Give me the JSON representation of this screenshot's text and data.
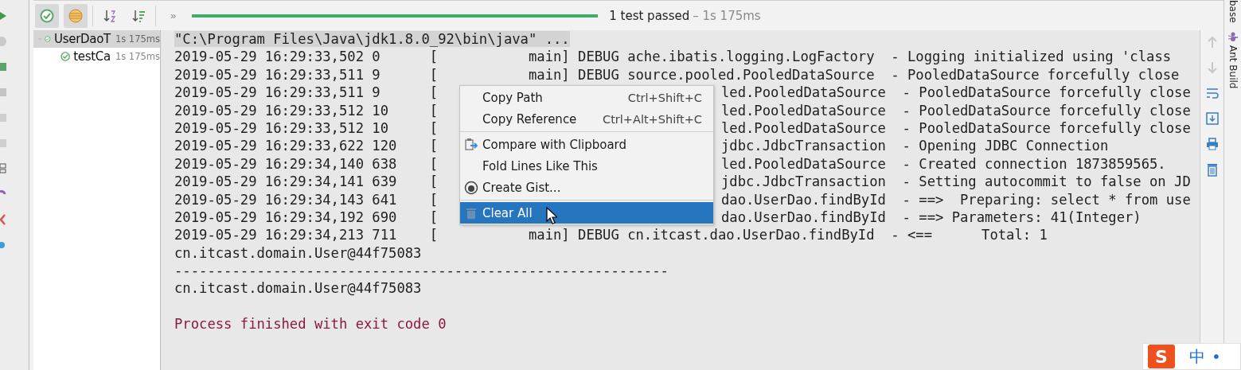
{
  "toolbar": {
    "buttons": [
      {
        "kind": "passed",
        "selected": true
      },
      {
        "kind": "ignored",
        "selected": true
      },
      {
        "kind": "sort-alpha",
        "selected": false
      },
      {
        "kind": "sort-duration",
        "selected": false
      }
    ],
    "overflow": "»",
    "progress": {
      "level": 1
    },
    "status": "1 test passed",
    "duration": "– 1s 175ms"
  },
  "tree": [
    {
      "name": "UserDaoT",
      "time": "1s 175ms",
      "selected": true,
      "expanded": true,
      "children": [
        {
          "name": "testCa",
          "time": "1s 175ms",
          "selected": false
        }
      ]
    }
  ],
  "console": {
    "lines": [
      {
        "kind": "command",
        "text": "\"C:\\Program Files\\Java\\jdk1.8.0_92\\bin\\java\" ..."
      },
      {
        "kind": "log",
        "text": "2019-05-29 16:29:33,502 0      [           main] DEBUG ache.ibatis.logging.LogFactory  - Logging initialized using 'class"
      },
      {
        "kind": "log",
        "text": "2019-05-29 16:29:33,511 9      [           main] DEBUG source.pooled.PooledDataSource  - PooledDataSource forcefully close"
      },
      {
        "kind": "split",
        "left": "2019-05-29 16:29:33,511 9      [",
        "right": "led.PooledDataSource  - PooledDataSource forcefully close"
      },
      {
        "kind": "split",
        "left": "2019-05-29 16:29:33,512 10     [",
        "right": "led.PooledDataSource  - PooledDataSource forcefully close"
      },
      {
        "kind": "split",
        "left": "2019-05-29 16:29:33,512 10     [",
        "right": "led.PooledDataSource  - PooledDataSource forcefully close"
      },
      {
        "kind": "split",
        "left": "2019-05-29 16:29:33,622 120    [",
        "right": "jdbc.JdbcTransaction  - Opening JDBC Connection"
      },
      {
        "kind": "split",
        "left": "2019-05-29 16:29:34,140 638    [",
        "right": "led.PooledDataSource  - Created connection 1873859565."
      },
      {
        "kind": "split",
        "left": "2019-05-29 16:29:34,141 639    [",
        "right": "jdbc.JdbcTransaction  - Setting autocommit to false on JD"
      },
      {
        "kind": "split",
        "left": "2019-05-29 16:29:34,143 641    [",
        "right": "dao.UserDao.findById  - ==>  Preparing: select * from use"
      },
      {
        "kind": "split",
        "left": "2019-05-29 16:29:34,192 690    [",
        "right": "dao.UserDao.findById  - ==> Parameters: 41(Integer)"
      },
      {
        "kind": "log",
        "text": "2019-05-29 16:29:34,213 711    [           main] DEBUG cn.itcast.dao.UserDao.findById  - <==      Total: 1"
      },
      {
        "kind": "log",
        "text": "cn.itcast.domain.User@44f75083"
      },
      {
        "kind": "log",
        "text": "------------------------------------------------------------"
      },
      {
        "kind": "log",
        "text": "cn.itcast.domain.User@44f75083"
      },
      {
        "kind": "blank"
      },
      {
        "kind": "exit",
        "text": "Process finished with exit code 0"
      }
    ]
  },
  "context_menu": {
    "items": [
      {
        "kind": "plain",
        "label": "Copy Path",
        "shortcut": "Ctrl+Shift+C",
        "selected": false
      },
      {
        "kind": "plain",
        "label": "Copy Reference",
        "shortcut": "Ctrl+Alt+Shift+C",
        "selected": false
      },
      {
        "kind": "separator"
      },
      {
        "kind": "compare",
        "label": "Compare with Clipboard",
        "selected": false
      },
      {
        "kind": "plain",
        "label": "Fold Lines Like This",
        "selected": false
      },
      {
        "kind": "gist",
        "label": "Create Gist...",
        "selected": false
      },
      {
        "kind": "separator"
      },
      {
        "kind": "clear",
        "label": "Clear All",
        "selected": true
      }
    ]
  },
  "side_toolbar": [
    {
      "kind": "up",
      "disabled": true
    },
    {
      "kind": "down",
      "disabled": true
    },
    {
      "kind": "wrap",
      "disabled": false
    },
    {
      "kind": "scroll-end",
      "disabled": false
    },
    {
      "kind": "print",
      "disabled": false
    },
    {
      "kind": "trash",
      "disabled": false
    }
  ],
  "right_strip": {
    "tabs": [
      {
        "kind": "plain",
        "label": "base"
      },
      {
        "kind": "ant",
        "label": "Ant Build"
      }
    ]
  },
  "ime_bar": {
    "logo": "S",
    "mode": "中",
    "dot": "•"
  }
}
